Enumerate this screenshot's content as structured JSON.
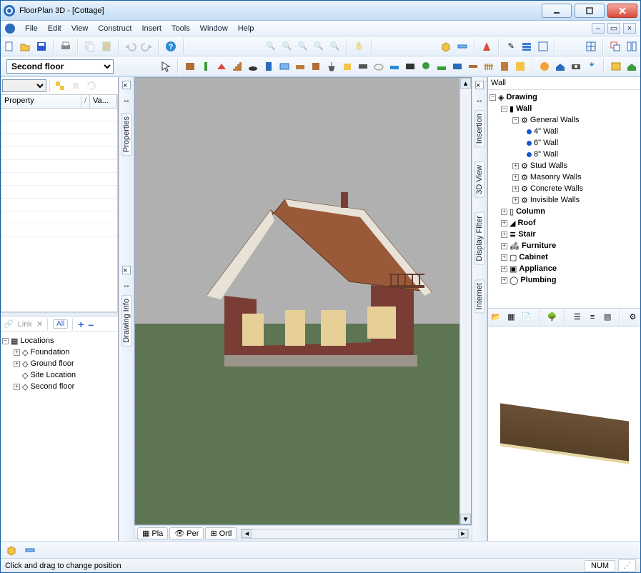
{
  "app": {
    "title": "FloorPlan 3D - [Cottage]"
  },
  "menu": {
    "items": [
      "File",
      "Edit",
      "View",
      "Construct",
      "Insert",
      "Tools",
      "Window",
      "Help"
    ]
  },
  "floor_selector": {
    "value": "Second floor"
  },
  "left": {
    "prop_filter_value": "",
    "prop_cols": {
      "c1": "Property",
      "c2": "Va..."
    },
    "loc_toolbar": {
      "link": "Link",
      "all": "All",
      "plus": "+",
      "minus": "–"
    },
    "locations_root": "Locations",
    "locations": [
      "Foundation",
      "Ground floor",
      "Site Location",
      "Second floor"
    ]
  },
  "rails": {
    "left_upper": "Properties",
    "left_lower": "Drawing Info",
    "right_tabs": [
      "Insertion",
      "3D View",
      "Display Filter",
      "Internet"
    ]
  },
  "view_tabs": {
    "t1": "Pla",
    "t2": "Per",
    "t3": "Ortl"
  },
  "right": {
    "header": "Wall",
    "root": "Drawing",
    "wall": "Wall",
    "general": "General Walls",
    "sizes": [
      "4\" Wall",
      "6\" Wall",
      "8\" Wall"
    ],
    "wall_groups": [
      "Stud Walls",
      "Masonry Walls",
      "Concrete Walls",
      "Invisible Walls"
    ],
    "cats": [
      "Column",
      "Roof",
      "Stair",
      "Furniture",
      "Cabinet",
      "Appliance",
      "Plumbing"
    ]
  },
  "status": {
    "text": "Click and drag to change position",
    "num": "NUM"
  }
}
